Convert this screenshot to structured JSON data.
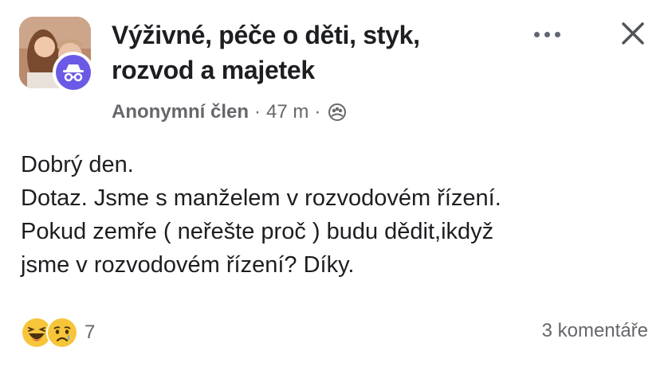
{
  "post": {
    "group_title_line1": "Výživné, péče o děti, styk,",
    "group_title_line2": "rozvod a majetek",
    "author": "Anonymní člen",
    "separator": "·",
    "timestamp": "47 m",
    "privacy_icon": "group-icon",
    "more_icon": "more-dots-icon",
    "close_icon": "close-icon",
    "body_lines": [
      "Dobrý den.",
      "Dotaz. Jsme s manželem v rozvodovém řízení.",
      "Pokud zemře ( neřešte proč ) budu dědit,ikdyž",
      "jsme v rozvodovém řízení? Díky."
    ],
    "reactions": {
      "icons": [
        "haha-emoji-icon",
        "sad-emoji-icon"
      ],
      "count": "7"
    },
    "comments_label": "3 komentáře"
  },
  "colors": {
    "text": "#1c1e21",
    "secondary": "#65676b",
    "anonymous_badge": "#6a5ae6",
    "emoji_yellow": "#f7c53a"
  }
}
